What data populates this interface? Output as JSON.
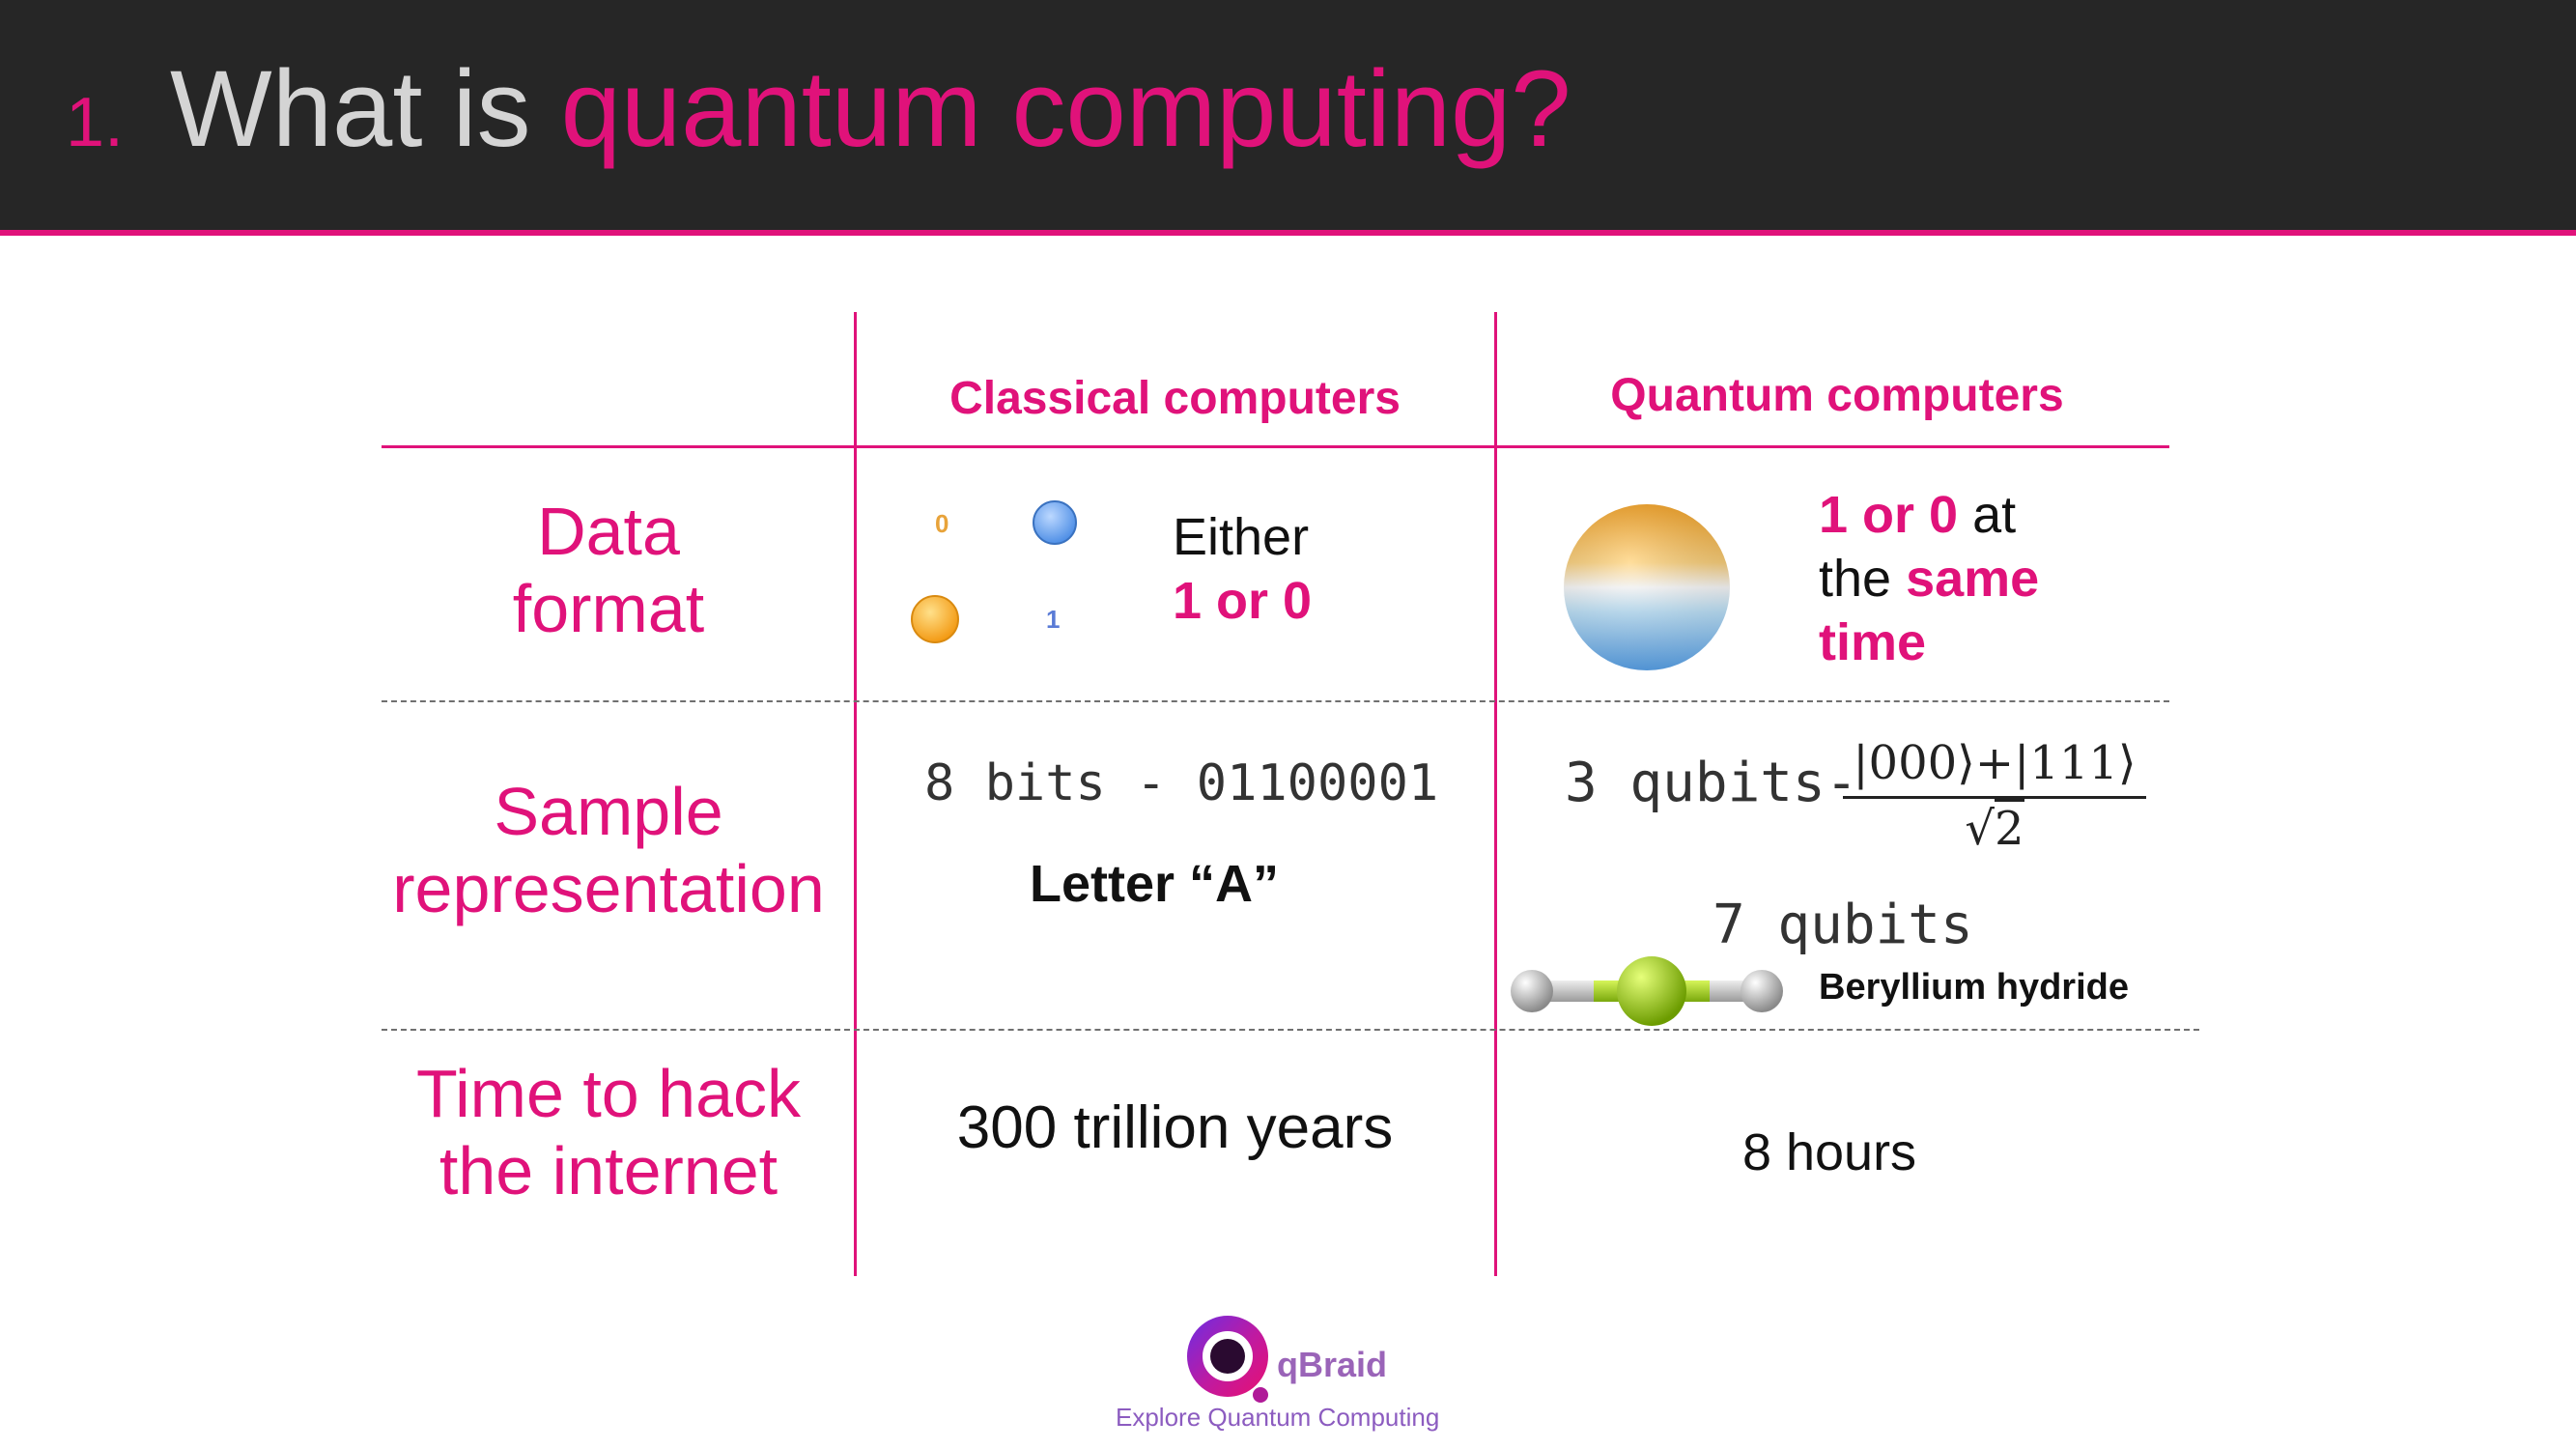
{
  "slide": {
    "number": "1.",
    "title_plain": "What is",
    "title_accent": "quantum computing?"
  },
  "columns": {
    "classical": "Classical computers",
    "quantum": "Quantum computers"
  },
  "rows": {
    "data_format": {
      "label_line1": "Data",
      "label_line2": "format",
      "classical": {
        "bit_zero": "0",
        "bit_one": "1",
        "text_line1": "Either",
        "text_line2": "1 or 0"
      },
      "quantum": {
        "line1_accent": "1 or 0",
        "line1_plain": "at",
        "line2_plain": "the",
        "line2_accent": "same",
        "line3_accent": "time"
      }
    },
    "sample": {
      "label_line1": "Sample",
      "label_line2": "representation",
      "classical": {
        "bits": "8 bits - 01100001",
        "letter": "Letter “A”"
      },
      "quantum": {
        "qubits3": "3 qubits-",
        "ket_numerator": "|000⟩+|111⟩",
        "sqrt_symbol": "√",
        "sqrt_value": "2",
        "qubits7": "7 qubits",
        "molecule": "Beryllium hydride"
      }
    },
    "hack": {
      "label_line1": "Time to hack",
      "label_line2": "the internet",
      "classical": "300 trillion years",
      "quantum": "8 hours"
    }
  },
  "logo": {
    "name": "qBraid",
    "tagline": "Explore Quantum Computing"
  },
  "colors": {
    "accent": "#e0127a",
    "header_bg": "#262626",
    "logo_purple": "#9a64b8"
  }
}
